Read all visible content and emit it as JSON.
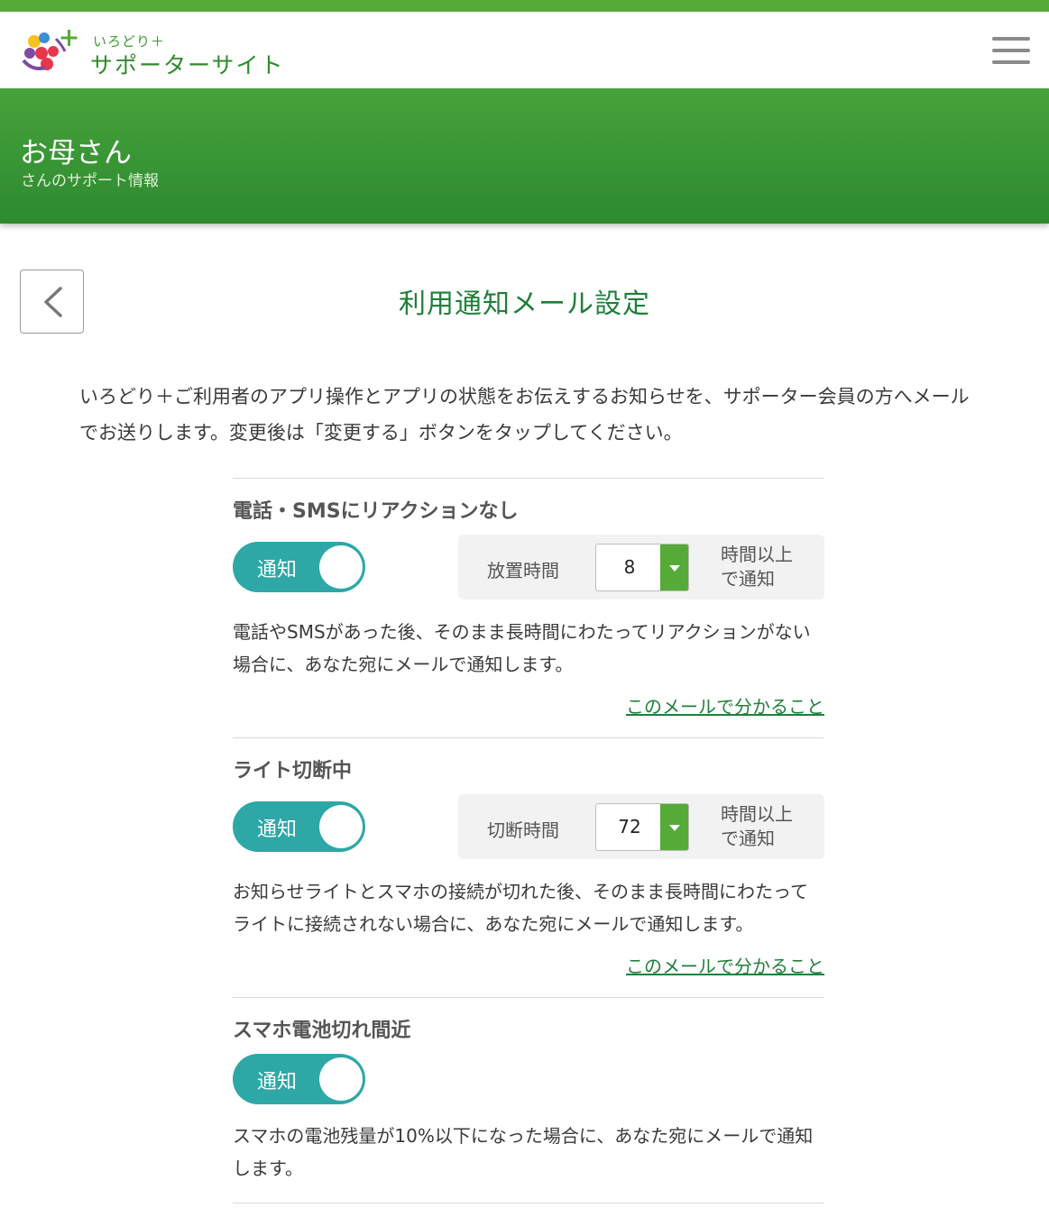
{
  "header": {
    "logo_sub": "いろどり＋",
    "logo_main": "サポーターサイト",
    "menu_icon": "hamburger-menu-icon"
  },
  "banner": {
    "name": "お母さん",
    "subtitle": "さんのサポート情報"
  },
  "page": {
    "back_icon": "chevron-left-icon",
    "title": "利用通知メール設定",
    "intro": "いろどり＋ご利用者のアプリ操作とアプリの状態をお伝えするお知らせを、サポーター会員の方へメールでお送りします。変更後は「変更する」ボタンをタップしてください。"
  },
  "sections": [
    {
      "title": "電話・SMSにリアクションなし",
      "toggle_label": "通知",
      "time_label": "放置時間",
      "time_value": "8",
      "time_suffix_1": "時間以上",
      "time_suffix_2": "で通知",
      "description": "電話やSMSがあった後、そのまま長時間にわたってリアクションがない場合に、あなた宛にメールで通知します。",
      "link": "このメールで分かること"
    },
    {
      "title": "ライト切断中",
      "toggle_label": "通知",
      "time_label": "切断時間",
      "time_value": "72",
      "time_suffix_1": "時間以上",
      "time_suffix_2": "で通知",
      "description": "お知らせライトとスマホの接続が切れた後、そのまま長時間にわたってライトに接続されない場合に、あなた宛にメールで通知します。",
      "link": "このメールで分かること"
    },
    {
      "title": "スマホ電池切れ間近",
      "toggle_label": "通知",
      "description": "スマホの電池残量が10%以下になった場合に、あなた宛にメールで通知します。"
    }
  ],
  "colors": {
    "brand_green": "#55aa38",
    "title_green": "#1f7f3a",
    "toggle_teal": "#2ea7a7"
  }
}
